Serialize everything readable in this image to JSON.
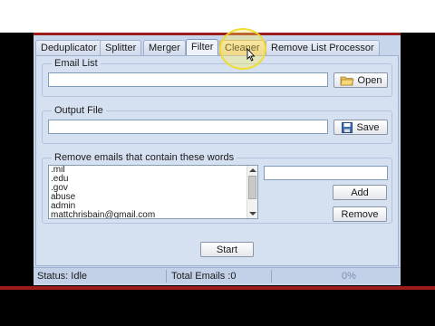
{
  "tabs": [
    {
      "label": "Deduplicator"
    },
    {
      "label": "Splitter"
    },
    {
      "label": "Merger"
    },
    {
      "label": "Filter"
    },
    {
      "label": "Cleaner"
    },
    {
      "label": "Remove List Processor"
    }
  ],
  "active_tab": "Filter",
  "email_list": {
    "label": "Email List",
    "value": "",
    "open_label": "Open",
    "open_icon": "folder-open-icon"
  },
  "output_file": {
    "label": "Output File",
    "value": "",
    "save_label": "Save",
    "save_icon": "floppy-disk-icon"
  },
  "remove_words": {
    "label": "Remove emails that contain these words",
    "items": [
      ".mil",
      ".edu",
      ".gov",
      "abuse",
      "admin",
      "mattchrisbain@gmail.com"
    ],
    "new_word_value": "",
    "add_label": "Add",
    "remove_label": "Remove"
  },
  "start_label": "Start",
  "status": {
    "status_text": "Status: Idle",
    "total_emails_text": "Total Emails :0",
    "progress_text": "0%"
  },
  "colors": {
    "window_bg": "#c8d6ec",
    "panel_bg": "#d5e0f1",
    "accent_red": "#9c1b1b",
    "highlight_yellow": "#f0dc28"
  }
}
